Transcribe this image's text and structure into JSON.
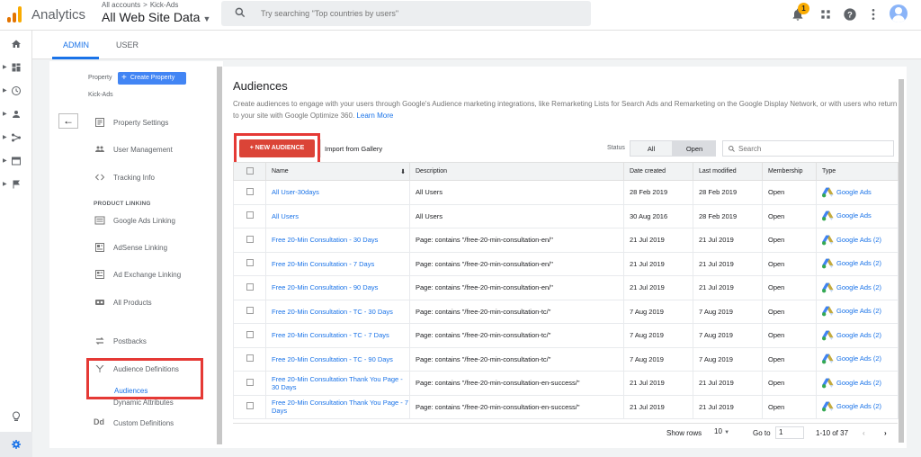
{
  "header": {
    "app_name": "Analytics",
    "breadcrumb_all_accounts": "All accounts",
    "breadcrumb_separator": ">",
    "breadcrumb_account": "Kick-Ads",
    "view_name": "All Web Site Data",
    "search_placeholder": "Try searching \"Top countries by users\"",
    "notification_count": "1"
  },
  "tabs": {
    "admin": "ADMIN",
    "user": "USER"
  },
  "property": {
    "label": "Property",
    "create_button": "Create Property",
    "name": "Kick-Ads"
  },
  "nav": {
    "property_settings": "Property Settings",
    "user_management": "User Management",
    "tracking_info": "Tracking Info",
    "product_linking_header": "PRODUCT LINKING",
    "google_ads_linking": "Google Ads Linking",
    "adsense_linking": "AdSense Linking",
    "ad_exchange_linking": "Ad Exchange Linking",
    "all_products": "All Products",
    "postbacks": "Postbacks",
    "audience_definitions": "Audience Definitions",
    "audiences": "Audiences",
    "dynamic_attributes": "Dynamic Attributes",
    "custom_definitions": "Custom Definitions"
  },
  "main": {
    "title": "Audiences",
    "description": "Create audiences to engage with your users through Google's Audience marketing integrations, like Remarketing Lists for Search Ads and Remarketing on the Google Display Network, or with users who return to your site with Google Optimize 360.",
    "learn_more": "Learn More",
    "new_audience_button": "+ NEW AUDIENCE",
    "import_button": "Import from Gallery",
    "status_label": "Status",
    "status_all": "All",
    "status_open": "Open",
    "search_placeholder": "Search"
  },
  "table": {
    "columns": [
      "Name",
      "Description",
      "Date created",
      "Last modified",
      "Membership",
      "Type"
    ],
    "rows": [
      {
        "name": "All User-30days",
        "description": "All Users",
        "created": "28 Feb 2019",
        "modified": "28 Feb 2019",
        "membership": "Open",
        "type": "Google Ads"
      },
      {
        "name": "All Users",
        "description": "All Users",
        "created": "30 Aug 2016",
        "modified": "28 Feb 2019",
        "membership": "Open",
        "type": "Google Ads"
      },
      {
        "name": "Free 20-Min Consultation - 30 Days",
        "description": "Page: contains \"/free-20-min-consultation-en/\"",
        "created": "21 Jul 2019",
        "modified": "21 Jul 2019",
        "membership": "Open",
        "type": "Google Ads (2)"
      },
      {
        "name": "Free 20-Min Consultation - 7 Days",
        "description": "Page: contains \"/free-20-min-consultation-en/\"",
        "created": "21 Jul 2019",
        "modified": "21 Jul 2019",
        "membership": "Open",
        "type": "Google Ads (2)"
      },
      {
        "name": "Free 20-Min Consultation - 90 Days",
        "description": "Page: contains \"/free-20-min-consultation-en/\"",
        "created": "21 Jul 2019",
        "modified": "21 Jul 2019",
        "membership": "Open",
        "type": "Google Ads (2)"
      },
      {
        "name": "Free 20-Min Consultation - TC - 30 Days",
        "description": "Page: contains \"/free-20-min-consultation-tc/\"",
        "created": "7 Aug 2019",
        "modified": "7 Aug 2019",
        "membership": "Open",
        "type": "Google Ads (2)"
      },
      {
        "name": "Free 20-Min Consultation - TC - 7 Days",
        "description": "Page: contains \"/free-20-min-consultation-tc/\"",
        "created": "7 Aug 2019",
        "modified": "7 Aug 2019",
        "membership": "Open",
        "type": "Google Ads (2)"
      },
      {
        "name": "Free 20-Min Consultation - TC - 90 Days",
        "description": "Page: contains \"/free-20-min-consultation-tc/\"",
        "created": "7 Aug 2019",
        "modified": "7 Aug 2019",
        "membership": "Open",
        "type": "Google Ads (2)"
      },
      {
        "name": "Free 20-Min Consultation Thank You Page - 30 Days",
        "description": "Page: contains \"/free-20-min-consultation-en-success/\"",
        "created": "21 Jul 2019",
        "modified": "21 Jul 2019",
        "membership": "Open",
        "type": "Google Ads (2)"
      },
      {
        "name": "Free 20-Min Consultation Thank You Page - 7 Days",
        "description": "Page: contains \"/free-20-min-consultation-en-success/\"",
        "created": "21 Jul 2019",
        "modified": "21 Jul 2019",
        "membership": "Open",
        "type": "Google Ads (2)"
      }
    ]
  },
  "pagination": {
    "show_rows_label": "Show rows",
    "rows_value": "10",
    "goto_label": "Go to",
    "goto_value": "1",
    "range": "1-10 of 37"
  },
  "colors": {
    "accent_blue": "#1a73e8",
    "new_audience_red": "#db4437",
    "highlight_red": "#e53935",
    "logo_orange": "#f9ab00",
    "logo_dark_orange": "#e37400"
  },
  "icons": {
    "rail": [
      "home-icon",
      "customization-icon",
      "realtime-icon",
      "audience-icon",
      "acquisition-icon",
      "behavior-icon",
      "conversions-icon",
      "discover-icon",
      "admin-gear-icon"
    ]
  }
}
